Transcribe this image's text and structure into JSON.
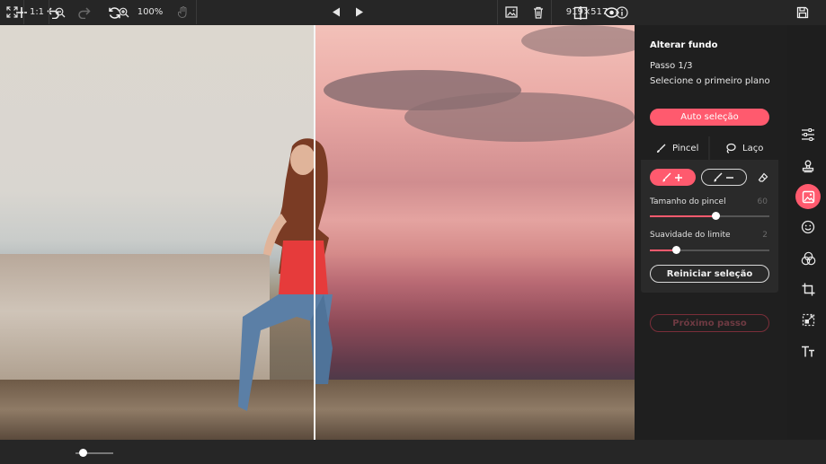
{
  "toolbar": {
    "icons": [
      "plus-icon",
      "undo-icon",
      "redo-icon",
      "refresh-icon",
      "compare-icon",
      "eye-icon",
      "save-icon"
    ]
  },
  "panel": {
    "title": "Alterar fundo",
    "step": "Passo 1/3",
    "instruction": "Selecione o primeiro plano",
    "auto_select_label": "Auto seleção",
    "tabs": [
      {
        "label": "Pincel"
      },
      {
        "label": "Laço"
      }
    ],
    "brush_size_label": "Tamanho do pincel",
    "brush_size_value": "60",
    "brush_size_fraction": 0.55,
    "edge_softness_label": "Suavidade do limite",
    "edge_softness_value": "2",
    "edge_softness_fraction": 0.22,
    "reset_label": "Reiniciar seleção",
    "next_step_label": "Próximo passo"
  },
  "rail": {
    "icons": [
      "sliders-icon",
      "stamp-icon",
      "image-icon",
      "face-icon",
      "circles-icon",
      "crop-icon",
      "resize-icon",
      "text-icon"
    ],
    "active": "image-icon"
  },
  "bottom": {
    "ratio_label": "1:1",
    "zoom_label": "100%",
    "zoom_fraction": 0.1,
    "dimensions": "919×517"
  },
  "colors": {
    "accent": "#ff5a6e",
    "background": "#1f1f1f"
  }
}
